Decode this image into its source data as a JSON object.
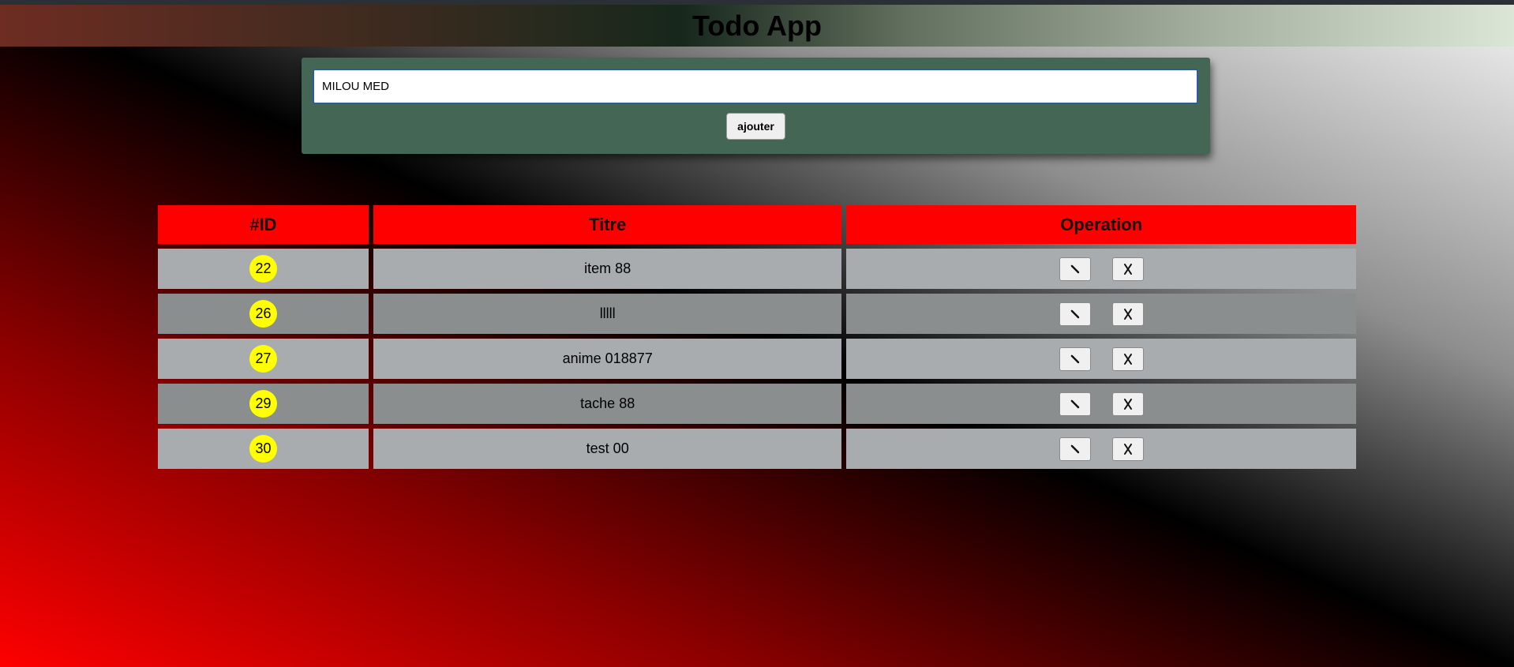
{
  "app": {
    "title": "Todo App"
  },
  "form": {
    "input_value": "MILOU MED",
    "add_label": "ajouter"
  },
  "table": {
    "headers": {
      "id": "#ID",
      "title": "Titre",
      "operation": "Operation"
    },
    "rows": [
      {
        "id": "22",
        "title": "item 88"
      },
      {
        "id": "26",
        "title": "lllll"
      },
      {
        "id": "27",
        "title": "anime 018877"
      },
      {
        "id": "29",
        "title": "tache 88"
      },
      {
        "id": "30",
        "title": "test 00"
      }
    ],
    "edit_icon": "pencil-icon",
    "delete_icon": "cross-icon"
  },
  "colors": {
    "header_cell": "#ff0000",
    "id_badge": "#ffff00",
    "form_panel": "#446654",
    "row_light": "#a9acae",
    "row_dark": "#8b8e8e"
  }
}
